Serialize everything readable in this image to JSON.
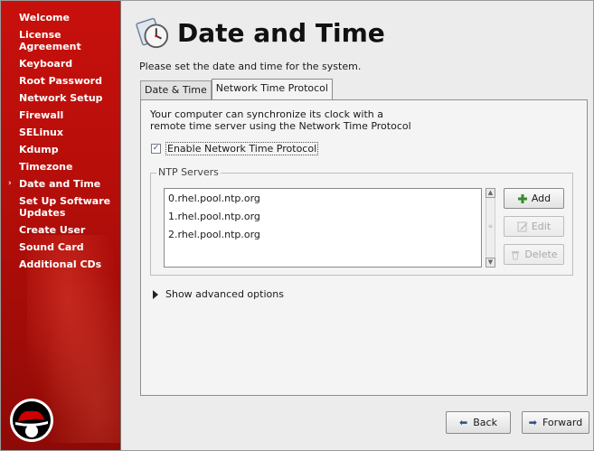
{
  "sidebar": {
    "items": [
      {
        "label": "Welcome"
      },
      {
        "label": "License Agreement"
      },
      {
        "label": "Keyboard"
      },
      {
        "label": "Root Password"
      },
      {
        "label": "Network Setup"
      },
      {
        "label": "Firewall"
      },
      {
        "label": "SELinux"
      },
      {
        "label": "Kdump"
      },
      {
        "label": "Timezone"
      },
      {
        "label": "Date and Time",
        "current": true
      },
      {
        "label": "Set Up Software Updates"
      },
      {
        "label": "Create User"
      },
      {
        "label": "Sound Card"
      },
      {
        "label": "Additional CDs"
      }
    ],
    "current_marker": "›"
  },
  "header": {
    "title": "Date and Time",
    "subtitle": "Please set the date and time for the system."
  },
  "tabs": [
    {
      "label": "Date & Time"
    },
    {
      "label": "Network Time Protocol",
      "active": true
    }
  ],
  "ntp": {
    "description_line1": "Your computer can synchronize its clock with a",
    "description_line2": "remote time server using the Network Time Protocol",
    "enable_label": "Enable Network Time Protocol",
    "enable_checked": true,
    "servers_frame_label": "NTP Servers",
    "servers": [
      "0.rhel.pool.ntp.org",
      "1.rhel.pool.ntp.org",
      "2.rhel.pool.ntp.org"
    ],
    "add_label": "Add",
    "edit_label": "Edit",
    "delete_label": "Delete",
    "advanced_label": "Show advanced options"
  },
  "footer": {
    "back_label": "Back",
    "forward_label": "Forward"
  },
  "colors": {
    "sidebar": "#b60e0a",
    "background": "#ececec"
  }
}
